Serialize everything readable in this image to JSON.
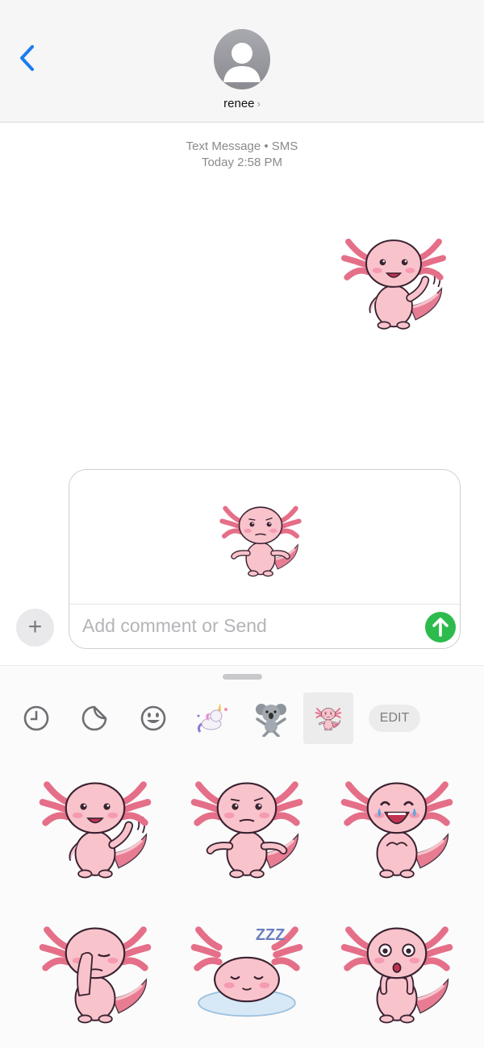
{
  "header": {
    "contact_name": "renee",
    "chevron": "›",
    "back_icon": "chevron-left-icon",
    "avatar_icon": "person-icon"
  },
  "thread": {
    "service_label": "Text Message • SMS",
    "timestamp_day": "Today",
    "timestamp_time": "2:58 PM",
    "sent_sticker": "axolotl-waving"
  },
  "composer": {
    "placeholder": "Add comment or Send",
    "preview_sticker": "axolotl-shrug",
    "plus_label": "+",
    "send_icon": "arrow-up-icon",
    "send_color": "#2dbb4d"
  },
  "drawer": {
    "tabs": [
      "recents-icon",
      "sticker-icon",
      "emoji-icon",
      "unicorn-sticker-pack",
      "koala-sticker-pack",
      "axolotl-sticker-pack"
    ],
    "edit_label": "EDIT",
    "stickers": [
      "axolotl-waving",
      "axolotl-shrug",
      "axolotl-laughing",
      "axolotl-facepalm",
      "axolotl-sleeping",
      "axolotl-surprised"
    ],
    "sleep_text": "ZZZ"
  },
  "colors": {
    "accent": "#1b7cf0",
    "axolotl_body": "#f9c3cc",
    "axolotl_gills": "#e56f88",
    "outline": "#3a2230"
  }
}
